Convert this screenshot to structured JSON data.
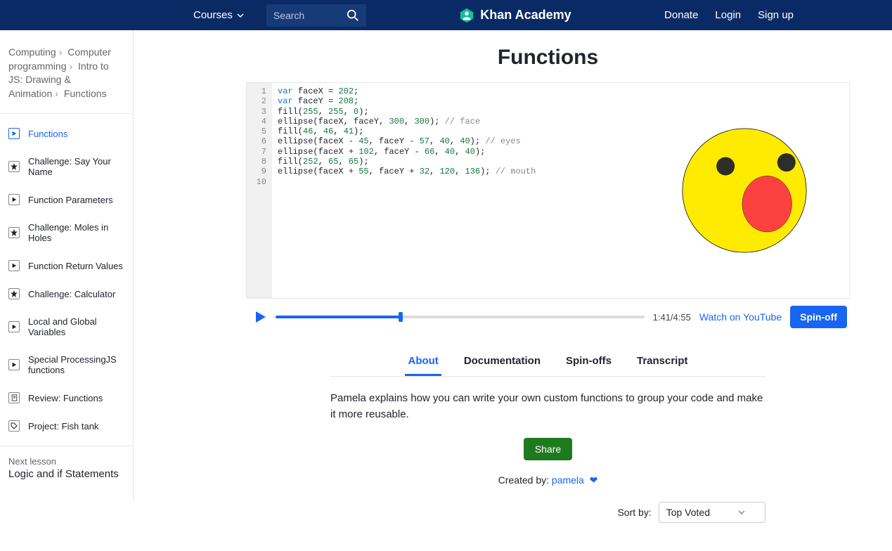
{
  "header": {
    "courses_label": "Courses",
    "search_placeholder": "Search",
    "brand": "Khan Academy",
    "donate": "Donate",
    "login": "Login",
    "signup": "Sign up"
  },
  "breadcrumb": {
    "parts": [
      "Computing",
      "Computer programming",
      "Intro to JS: Drawing & Animation",
      "Functions"
    ]
  },
  "lessons": [
    {
      "label": "Functions",
      "icon": "play",
      "active": true
    },
    {
      "label": "Challenge: Say Your Name",
      "icon": "star"
    },
    {
      "label": "Function Parameters",
      "icon": "play"
    },
    {
      "label": "Challenge: Moles in Holes",
      "icon": "star"
    },
    {
      "label": "Function Return Values",
      "icon": "play"
    },
    {
      "label": "Challenge: Calculator",
      "icon": "star"
    },
    {
      "label": "Local and Global Variables",
      "icon": "play"
    },
    {
      "label": "Special ProcessingJS functions",
      "icon": "play"
    },
    {
      "label": "Review: Functions",
      "icon": "doc"
    },
    {
      "label": "Project: Fish tank",
      "icon": "tag"
    }
  ],
  "next_lesson": {
    "label": "Next lesson",
    "title": "Logic and if Statements"
  },
  "page_title": "Functions",
  "code_lines": [
    "var faceX = 202;",
    "var faceY = 208;",
    "fill(255, 255, 0);",
    "ellipse(faceX, faceY, 300, 300); // face",
    "fill(46, 46, 41);",
    "ellipse(faceX - 45, faceY - 57, 40, 40); // eyes",
    "ellipse(faceX + 102, faceY - 66, 40, 40);",
    "fill(252, 65, 65);",
    "ellipse(faceX + 55, faceY + 32, 120, 136); // mouth",
    ""
  ],
  "controls": {
    "time": "1:41/4:55",
    "progress_pct": 34,
    "youtube_label": "Watch on YouTube",
    "spinoff_label": "Spin-off"
  },
  "tabs": [
    "About",
    "Documentation",
    "Spin-offs",
    "Transcript"
  ],
  "active_tab": 0,
  "description": "Pamela explains how you can write your own custom functions to group your code and make it more reusable.",
  "share_label": "Share",
  "created_by_label": "Created by: ",
  "author": "pamela",
  "sort": {
    "label": "Sort by:",
    "value": "Top Voted"
  }
}
